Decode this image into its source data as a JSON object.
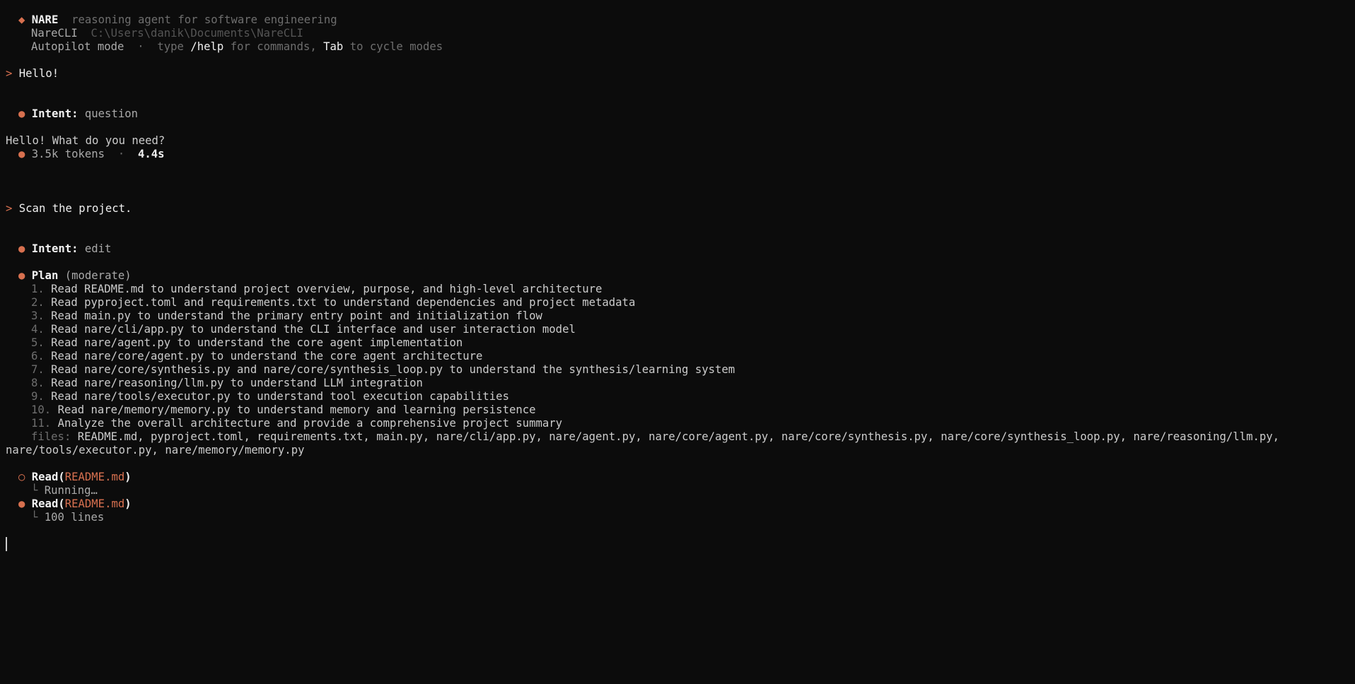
{
  "header": {
    "diamond": "◆",
    "app_name": "NARE",
    "tagline": "reasoning agent for software engineering",
    "project_name": "NareCLI",
    "project_path": "C:\\Users\\danik\\Documents\\NareCLI",
    "mode": "Autopilot mode",
    "sep": "·",
    "hint_type": "type",
    "hint_help": "/help",
    "hint_commands": "for commands,",
    "hint_tab": "Tab",
    "hint_cycle": "to cycle modes"
  },
  "prompt_char": ">",
  "bullet": "●",
  "bullet_open": "○",
  "exchange1": {
    "user": "Hello!",
    "intent_label": "Intent:",
    "intent_value": "question",
    "reply": "Hello! What do you need?",
    "tokens": "3.5k tokens",
    "sep": "·",
    "time": "4.4s"
  },
  "exchange2": {
    "user": "Scan the project.",
    "intent_label": "Intent:",
    "intent_value": "edit",
    "plan_label": "Plan",
    "plan_level": "(moderate)",
    "steps": [
      {
        "num": "1.",
        "text": "Read README.md to understand project overview, purpose, and high-level architecture"
      },
      {
        "num": "2.",
        "text": "Read pyproject.toml and requirements.txt to understand dependencies and project metadata"
      },
      {
        "num": "3.",
        "text": "Read main.py to understand the primary entry point and initialization flow"
      },
      {
        "num": "4.",
        "text": "Read nare/cli/app.py to understand the CLI interface and user interaction model"
      },
      {
        "num": "5.",
        "text": "Read nare/agent.py to understand the core agent implementation"
      },
      {
        "num": "6.",
        "text": "Read nare/core/agent.py to understand the core agent architecture"
      },
      {
        "num": "7.",
        "text": "Read nare/core/synthesis.py and nare/core/synthesis_loop.py to understand the synthesis/learning system"
      },
      {
        "num": "8.",
        "text": "Read nare/reasoning/llm.py to understand LLM integration"
      },
      {
        "num": "9.",
        "text": "Read nare/tools/executor.py to understand tool execution capabilities"
      },
      {
        "num": "10.",
        "text": "Read nare/memory/memory.py to understand memory and learning persistence"
      },
      {
        "num": "11.",
        "text": "Analyze the overall architecture and provide a comprehensive project summary"
      }
    ],
    "files_label": "files:",
    "files_line1": "README.md, pyproject.toml, requirements.txt, main.py, nare/cli/app.py, nare/agent.py, nare/core/agent.py, nare/core/synthesis.py, nare/core/synthesis_loop.py, nare/reasoning/llm.py,",
    "files_line2": "nare/tools/executor.py, nare/memory/memory.py",
    "tool1": {
      "name": "Read(",
      "arg": "README.md",
      "close": ")",
      "branch": "└",
      "status": "Running…"
    },
    "tool2": {
      "name": "Read(",
      "arg": "README.md",
      "close": ")",
      "branch": "└",
      "status": "100 lines"
    }
  }
}
